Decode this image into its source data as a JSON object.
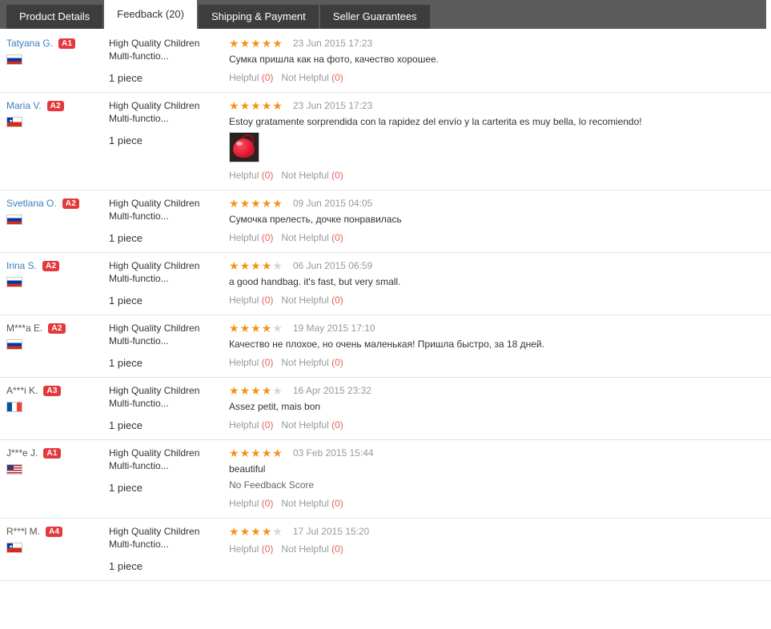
{
  "tabs": [
    {
      "label": "Product Details",
      "active": false
    },
    {
      "label": "Feedback (20)",
      "active": true
    },
    {
      "label": "Shipping & Payment",
      "active": false
    },
    {
      "label": "Seller Guarantees",
      "active": false
    }
  ],
  "colors": {
    "tabbar_bg": "#5b5b5b",
    "tab_bg": "#3d3d3d",
    "tab_active_bg": "#ffffff",
    "link_blue": "#3b7ec0",
    "badge_red": "#e4393c",
    "star_on": "#f4921e",
    "star_off": "#d6d6d6",
    "count_red": "#e4605a",
    "muted": "#999999"
  },
  "labels": {
    "helpful": "Helpful",
    "not_helpful": "Not Helpful",
    "helpful_count": "(0)",
    "not_helpful_count": "(0)",
    "no_feedback_score": "No Feedback Score"
  },
  "feedback": [
    {
      "user": "Tatyana G.",
      "user_is_link": true,
      "level": "A1",
      "country": "ru",
      "product": "High Quality Children Multi-functio...",
      "quantity": "1 piece",
      "rating": 5,
      "date": "23 Jun 2015 17:23",
      "comment": "Сумка пришла как на фото, качество хорошее.",
      "has_image": false,
      "no_score": false
    },
    {
      "user": "Maria V.",
      "user_is_link": true,
      "level": "A2",
      "country": "cl",
      "product": "High Quality Children Multi-functio...",
      "quantity": "1 piece",
      "rating": 5,
      "date": "23 Jun 2015 17:23",
      "comment": "Estoy gratamente sorprendida con la rapidez del envío y la carterita es muy bella, lo recomiendo!",
      "has_image": true,
      "no_score": false
    },
    {
      "user": "Svetlana O.",
      "user_is_link": true,
      "level": "A2",
      "country": "ru",
      "product": "High Quality Children Multi-functio...",
      "quantity": "1 piece",
      "rating": 5,
      "date": "09 Jun 2015 04:05",
      "comment": "Сумочка прелесть, дочке понравилась",
      "has_image": false,
      "no_score": false
    },
    {
      "user": "Irina S.",
      "user_is_link": true,
      "level": "A2",
      "country": "ru",
      "product": "High Quality Children Multi-functio...",
      "quantity": "1 piece",
      "rating": 4,
      "date": "06 Jun 2015 06:59",
      "comment": "a good handbag. it's fast, but very small.",
      "has_image": false,
      "no_score": false
    },
    {
      "user": "M***a E.",
      "user_is_link": false,
      "level": "A2",
      "country": "ru",
      "product": "High Quality Children Multi-functio...",
      "quantity": "1 piece",
      "rating": 4,
      "date": "19 May 2015 17:10",
      "comment": "Качество не плохое, но очень маленькая! Пришла быстро, за 18 дней.",
      "has_image": false,
      "no_score": false
    },
    {
      "user": "A***i K.",
      "user_is_link": false,
      "level": "A3",
      "country": "fr",
      "product": "High Quality Children Multi-functio...",
      "quantity": "1 piece",
      "rating": 4,
      "date": "16 Apr 2015 23:32",
      "comment": "Assez petit, mais bon",
      "has_image": false,
      "no_score": false
    },
    {
      "user": "J***e J.",
      "user_is_link": false,
      "level": "A1",
      "country": "us",
      "product": "High Quality Children Multi-functio...",
      "quantity": "1 piece",
      "rating": 5,
      "date": "03 Feb 2015 15:44",
      "comment": "beautiful",
      "has_image": false,
      "no_score": true
    },
    {
      "user": "R***l M.",
      "user_is_link": false,
      "level": "A4",
      "country": "cl",
      "product": "High Quality Children Multi-functio...",
      "quantity": "1 piece",
      "rating": 4,
      "date": "17 Jul 2015 15:20",
      "comment": "",
      "has_image": false,
      "no_score": false
    }
  ]
}
